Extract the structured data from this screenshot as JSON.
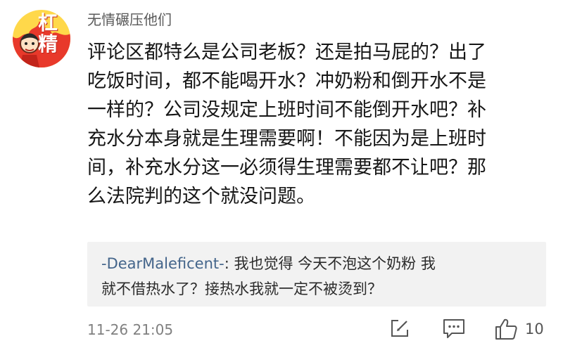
{
  "comment": {
    "avatar_text": "杠精",
    "username": "无情碾压他们",
    "body_lines": [
      "评论区都特么是公司老板？还是拍马屁的？出了",
      "吃饭时间，都不能喝开水？冲奶粉和倒开水不是",
      "一样的？公司没规定上班时间不能倒开水吧？补",
      "充水分本身就是生理需要啊！不能因为是上班时",
      "间，补充水分这一必须得生理需要都不让吧？那",
      "么法院判的这个就没问题。"
    ],
    "reply": {
      "author": "-DearMaleficent-",
      "separator": ": ",
      "line1_text": "我也觉得 今天不泡这个奶粉 我",
      "line2_text": "就不借热水了？接热水我就一定不被烫到？"
    },
    "timestamp": "11-26 21:05",
    "like_count": "10"
  },
  "icons": {
    "edit": "edit-icon",
    "comment": "comment-icon",
    "like": "thumbs-up-icon"
  },
  "colors": {
    "avatar_bg": "#ffd84a",
    "avatar_flame": "#e8392b",
    "reply_author": "#44658b",
    "quote_bg": "#f2f2f2"
  }
}
